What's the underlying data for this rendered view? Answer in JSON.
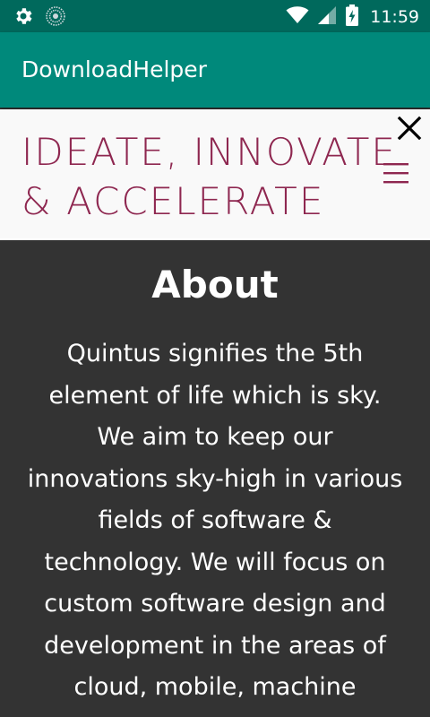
{
  "status_bar": {
    "time": "11:59",
    "icons": [
      "settings-icon",
      "sync-icon",
      "wifi-icon",
      "signal-icon",
      "battery-charging-icon"
    ]
  },
  "app_bar": {
    "title": "DownloadHelper"
  },
  "site_header": {
    "tagline": "IDEATE, INNOVATE\n& ACCELERATE",
    "close_icon": "close-icon",
    "menu_icon": "hamburger-menu-icon"
  },
  "about": {
    "title": "About",
    "body": "Quintus signifies the 5th element of life which is sky. We aim to keep our innovations sky-high in various fields of software & technology. We will focus on custom software design and development in the areas of cloud, mobile, machine"
  },
  "colors": {
    "status_bar": "#00695c",
    "app_bar": "#00897b",
    "tagline": "#8e2750",
    "about_bg": "#333333"
  }
}
